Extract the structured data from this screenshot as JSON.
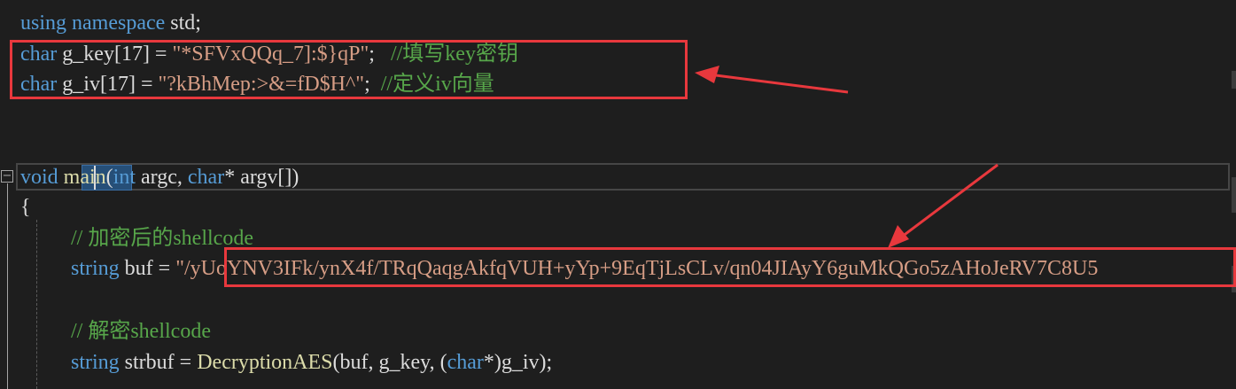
{
  "colors": {
    "background": "#1e1e1e",
    "keyword": "#569cd6",
    "type": "#4ec9b0",
    "string": "#d69d85",
    "comment": "#57a64a",
    "identifier": "#dcdcdc",
    "function": "#dcdcaa",
    "annotation": "#e8383d"
  },
  "code": {
    "line1": {
      "kw1": "using",
      "kw2": "namespace",
      "rest": " std;"
    },
    "line2": {
      "kw": "char",
      "decl": " g_key[17] = ",
      "str": "\"*SFVxQQq_7]:$}qP\"",
      "punct": ";   ",
      "comment": "//填写key密钥"
    },
    "line3": {
      "kw": "char",
      "decl": " g_iv[17] = ",
      "str": "\"?kBhMep:>&=fD$H^\"",
      "punct": ";  ",
      "comment": "//定义iv向量"
    },
    "line4": {
      "kw_void": "void",
      "fn": "main",
      "open": "(",
      "kw_int": "int",
      "arg1": " argc, ",
      "kw_char": "char",
      "arg2": "* argv[])"
    },
    "line5": {
      "brace": "{"
    },
    "line6": {
      "comment": "// 加密后的shellcode"
    },
    "line7": {
      "type": "string",
      "decl": " buf = ",
      "str": "\"/yUoYNV3IFk/ynX4f/TRqQaqgAkfqVUH+yYp+9EqTjLsCLv/qn04JIAyY6guMkQGo5zAHoJeRV7C8U5"
    },
    "line8": {
      "comment": "// 解密shellcode"
    },
    "line9": {
      "type": "string",
      "decl": " strbuf = ",
      "fn": "DecryptionAES",
      "args1": "(buf, g_key, (",
      "kw_char": "char",
      "args2": "*)g_iv);"
    }
  },
  "gutter": {
    "fold_glyph": "−"
  },
  "annotations": [
    {
      "label": "key-iv-box"
    },
    {
      "label": "encrypted-buf-box"
    }
  ]
}
